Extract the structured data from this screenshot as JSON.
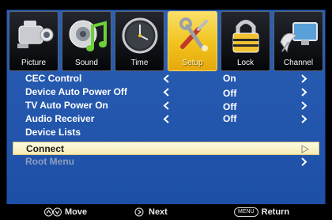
{
  "tabs": [
    {
      "label": "Picture",
      "icon": "camcorder-icon"
    },
    {
      "label": "Sound",
      "icon": "speaker-note-icon"
    },
    {
      "label": "Time",
      "icon": "clock-icon"
    },
    {
      "label": "Setup",
      "icon": "tools-icon",
      "active": true
    },
    {
      "label": "Lock",
      "icon": "padlock-icon"
    },
    {
      "label": "Channel",
      "icon": "satellite-dish-icon"
    }
  ],
  "menu": {
    "items": [
      {
        "label": "CEC Control",
        "value": "On"
      },
      {
        "label": "Device Auto Power Off",
        "value": "Off"
      },
      {
        "label": "TV Auto Power On",
        "value": "Off"
      },
      {
        "label": "Audio Receiver",
        "value": "Off"
      },
      {
        "label": "Device Lists"
      },
      {
        "label": "Connect"
      },
      {
        "label": "Root Menu"
      }
    ]
  },
  "help": {
    "move": "Move",
    "next": "Next",
    "menu_key": "MENU",
    "return": "Return"
  },
  "colors": {
    "panel": "#2258ad",
    "highlight": "#f6ecb4",
    "active_tab": "#f1c21b"
  }
}
